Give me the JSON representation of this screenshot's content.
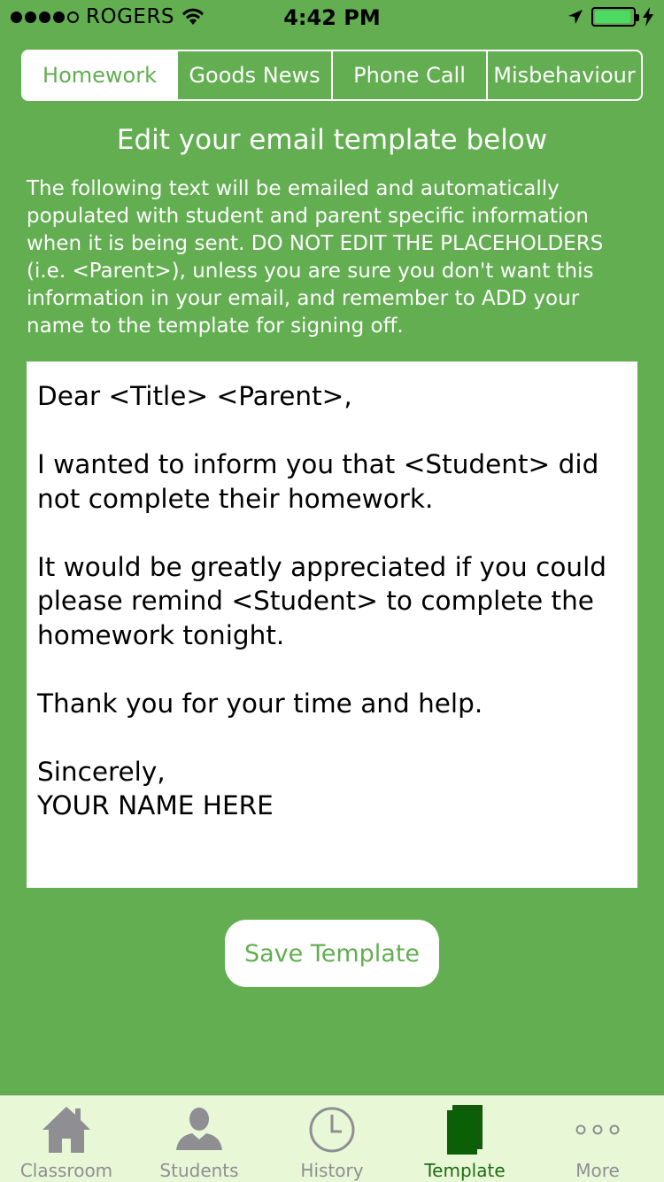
{
  "status_bar": {
    "carrier": "ROGERS",
    "time": "4:42 PM"
  },
  "segments": [
    {
      "label": "Homework",
      "active": true
    },
    {
      "label": "Goods News",
      "active": false
    },
    {
      "label": "Phone Call",
      "active": false
    },
    {
      "label": "Misbehaviour",
      "active": false
    }
  ],
  "heading": "Edit your email template below",
  "instructions": "The following text will be emailed and automatically populated with student and parent specific information when it is being sent. DO NOT EDIT THE PLACEHOLDERS (i.e. <Parent>), unless you are sure you don't want this information in your email, and remember to ADD your name to the template for signing off.",
  "template_text": "Dear <Title> <Parent>,\n\nI wanted to inform you that <Student> did not complete their homework.\n\nIt would be greatly appreciated if you could please remind <Student> to complete the homework tonight.\n\nThank you for your time and help.\n\nSincerely,\nYOUR NAME HERE",
  "save_button": "Save Template",
  "tabs": [
    {
      "label": "Classroom",
      "icon": "house-icon",
      "active": false
    },
    {
      "label": "Students",
      "icon": "person-icon",
      "active": false
    },
    {
      "label": "History",
      "icon": "clock-icon",
      "active": false
    },
    {
      "label": "Template",
      "icon": "document-icon",
      "active": true
    },
    {
      "label": "More",
      "icon": "more-dots-icon",
      "active": false
    }
  ],
  "colors": {
    "background": "#62ae51",
    "accent": "#62ae51",
    "tab_bar": "#e8f8d6",
    "tab_active": "#1e6b12",
    "tab_inactive": "#8e8e93"
  }
}
